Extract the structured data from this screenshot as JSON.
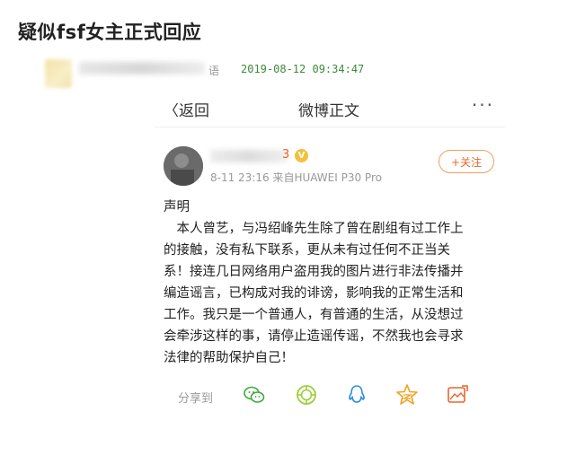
{
  "post": {
    "title": "疑似fsf女主正式回应",
    "name_tail": "语",
    "time": "2019-08-12 09:34:47"
  },
  "screenshot": {
    "topbar": {
      "back": "〈返回",
      "title": "微博正文",
      "more": "···"
    },
    "user": {
      "name_tail": "3",
      "meta": "8-11 23:16  来自HUAWEI P30 Pro",
      "follow": "+关注"
    },
    "body": {
      "heading": "声明",
      "lines": [
        "　本人曾艺，与冯绍峰先生除了曾在剧组有过工作上",
        "的接触，没有私下联系，更从未有过任何不正当关",
        "系！接连几日网络用户盗用我的图片进行非法传播并",
        "编造谣言，已构成对我的诽谤，影响我的正常生活和",
        "工作。我只是一个普通人，有普通的生活，从没想过",
        "会牵涉这样的事，请停止造谣传谣，不然我也会寻求",
        "法律的帮助保护自己！"
      ]
    },
    "share": {
      "label": "分享到",
      "icons": [
        "wechat-icon",
        "moments-icon",
        "qq-icon",
        "qzone-icon",
        "weibo-image-icon"
      ]
    }
  },
  "colors": {
    "accent": "#e8662a",
    "time": "#3d8a3a",
    "icon_green": "#3caa3c",
    "icon_blue": "#2b8fd6",
    "icon_orange": "#f0a020"
  }
}
